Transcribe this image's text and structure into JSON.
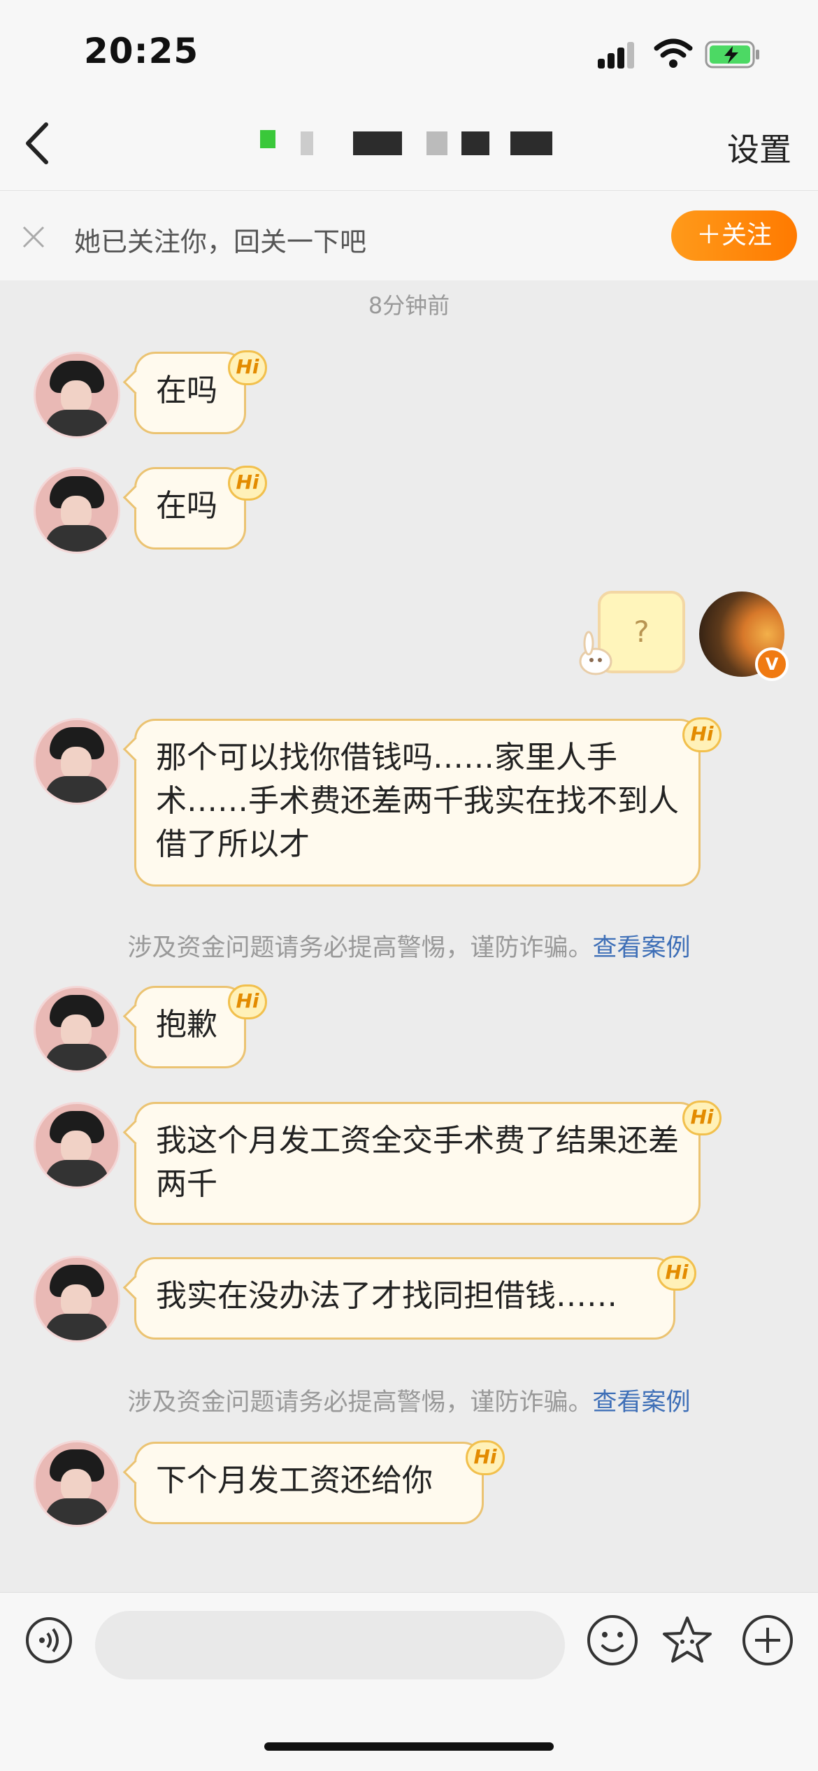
{
  "status_bar": {
    "time": "20:25"
  },
  "nav": {
    "settings_label": "设置"
  },
  "follow_banner": {
    "text": "她已关注你，回关一下吧",
    "button_label": "＋关注"
  },
  "timestamp": "8分钟前",
  "hi_badge": "Hi",
  "messages": [
    {
      "text": "在吗"
    },
    {
      "text": "在吗"
    },
    {
      "text": "那个可以找你借钱吗……家里人手术……手术费还差两千我实在找不到人借了所以才"
    },
    {
      "text": "抱歉"
    },
    {
      "text": "我这个月发工资全交手术费了结果还差两千"
    },
    {
      "text": "我实在没办法了才找同担借钱……"
    },
    {
      "text": "下个月发工资还给你"
    }
  ],
  "sticker_text": "?",
  "warning": {
    "text": "涉及资金问题请务必提高警惕，谨防诈骗。",
    "link": "查看案例"
  },
  "colors": {
    "accent": "#ff8a00",
    "bubble_border": "#ebc372",
    "link": "#3e6fb7"
  }
}
